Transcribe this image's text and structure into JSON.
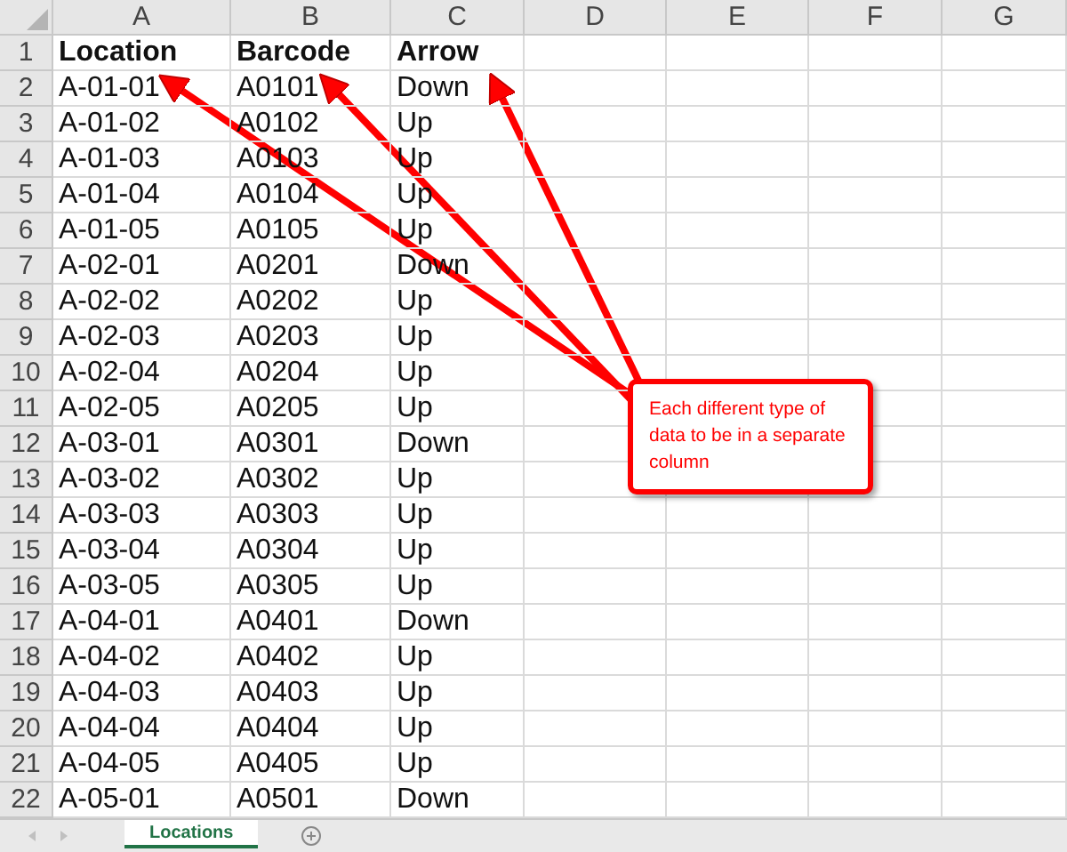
{
  "columns": [
    "A",
    "B",
    "C",
    "D",
    "E",
    "F",
    "G"
  ],
  "rows": [
    {
      "number": "1",
      "kind": "header",
      "cells": [
        "Location",
        "Barcode",
        "Arrow"
      ]
    },
    {
      "number": "2",
      "kind": "data",
      "cells": [
        "A-01-01",
        "A0101",
        "Down"
      ]
    },
    {
      "number": "3",
      "kind": "data",
      "cells": [
        "A-01-02",
        "A0102",
        "Up"
      ]
    },
    {
      "number": "4",
      "kind": "data",
      "cells": [
        "A-01-03",
        "A0103",
        "Up"
      ]
    },
    {
      "number": "5",
      "kind": "data",
      "cells": [
        "A-01-04",
        "A0104",
        "Up"
      ]
    },
    {
      "number": "6",
      "kind": "data",
      "cells": [
        "A-01-05",
        "A0105",
        "Up"
      ]
    },
    {
      "number": "7",
      "kind": "data",
      "cells": [
        "A-02-01",
        "A0201",
        "Down"
      ]
    },
    {
      "number": "8",
      "kind": "data",
      "cells": [
        "A-02-02",
        "A0202",
        "Up"
      ]
    },
    {
      "number": "9",
      "kind": "data",
      "cells": [
        "A-02-03",
        "A0203",
        "Up"
      ]
    },
    {
      "number": "10",
      "kind": "data",
      "cells": [
        "A-02-04",
        "A0204",
        "Up"
      ]
    },
    {
      "number": "11",
      "kind": "data",
      "cells": [
        "A-02-05",
        "A0205",
        "Up"
      ]
    },
    {
      "number": "12",
      "kind": "data",
      "cells": [
        "A-03-01",
        "A0301",
        "Down"
      ]
    },
    {
      "number": "13",
      "kind": "data",
      "cells": [
        "A-03-02",
        "A0302",
        "Up"
      ]
    },
    {
      "number": "14",
      "kind": "data",
      "cells": [
        "A-03-03",
        "A0303",
        "Up"
      ]
    },
    {
      "number": "15",
      "kind": "data",
      "cells": [
        "A-03-04",
        "A0304",
        "Up"
      ]
    },
    {
      "number": "16",
      "kind": "data",
      "cells": [
        "A-03-05",
        "A0305",
        "Up"
      ]
    },
    {
      "number": "17",
      "kind": "data",
      "cells": [
        "A-04-01",
        "A0401",
        "Down"
      ]
    },
    {
      "number": "18",
      "kind": "data",
      "cells": [
        "A-04-02",
        "A0402",
        "Up"
      ]
    },
    {
      "number": "19",
      "kind": "data",
      "cells": [
        "A-04-03",
        "A0403",
        "Up"
      ]
    },
    {
      "number": "20",
      "kind": "data",
      "cells": [
        "A-04-04",
        "A0404",
        "Up"
      ]
    },
    {
      "number": "21",
      "kind": "data",
      "cells": [
        "A-04-05",
        "A0405",
        "Up"
      ]
    },
    {
      "number": "22",
      "kind": "data",
      "cells": [
        "A-05-01",
        "A0501",
        "Down"
      ]
    }
  ],
  "callout": {
    "text": "Each different type of data to be in a separate column"
  },
  "sheet_tabs": [
    {
      "label": "Locations",
      "selected": true
    }
  ]
}
